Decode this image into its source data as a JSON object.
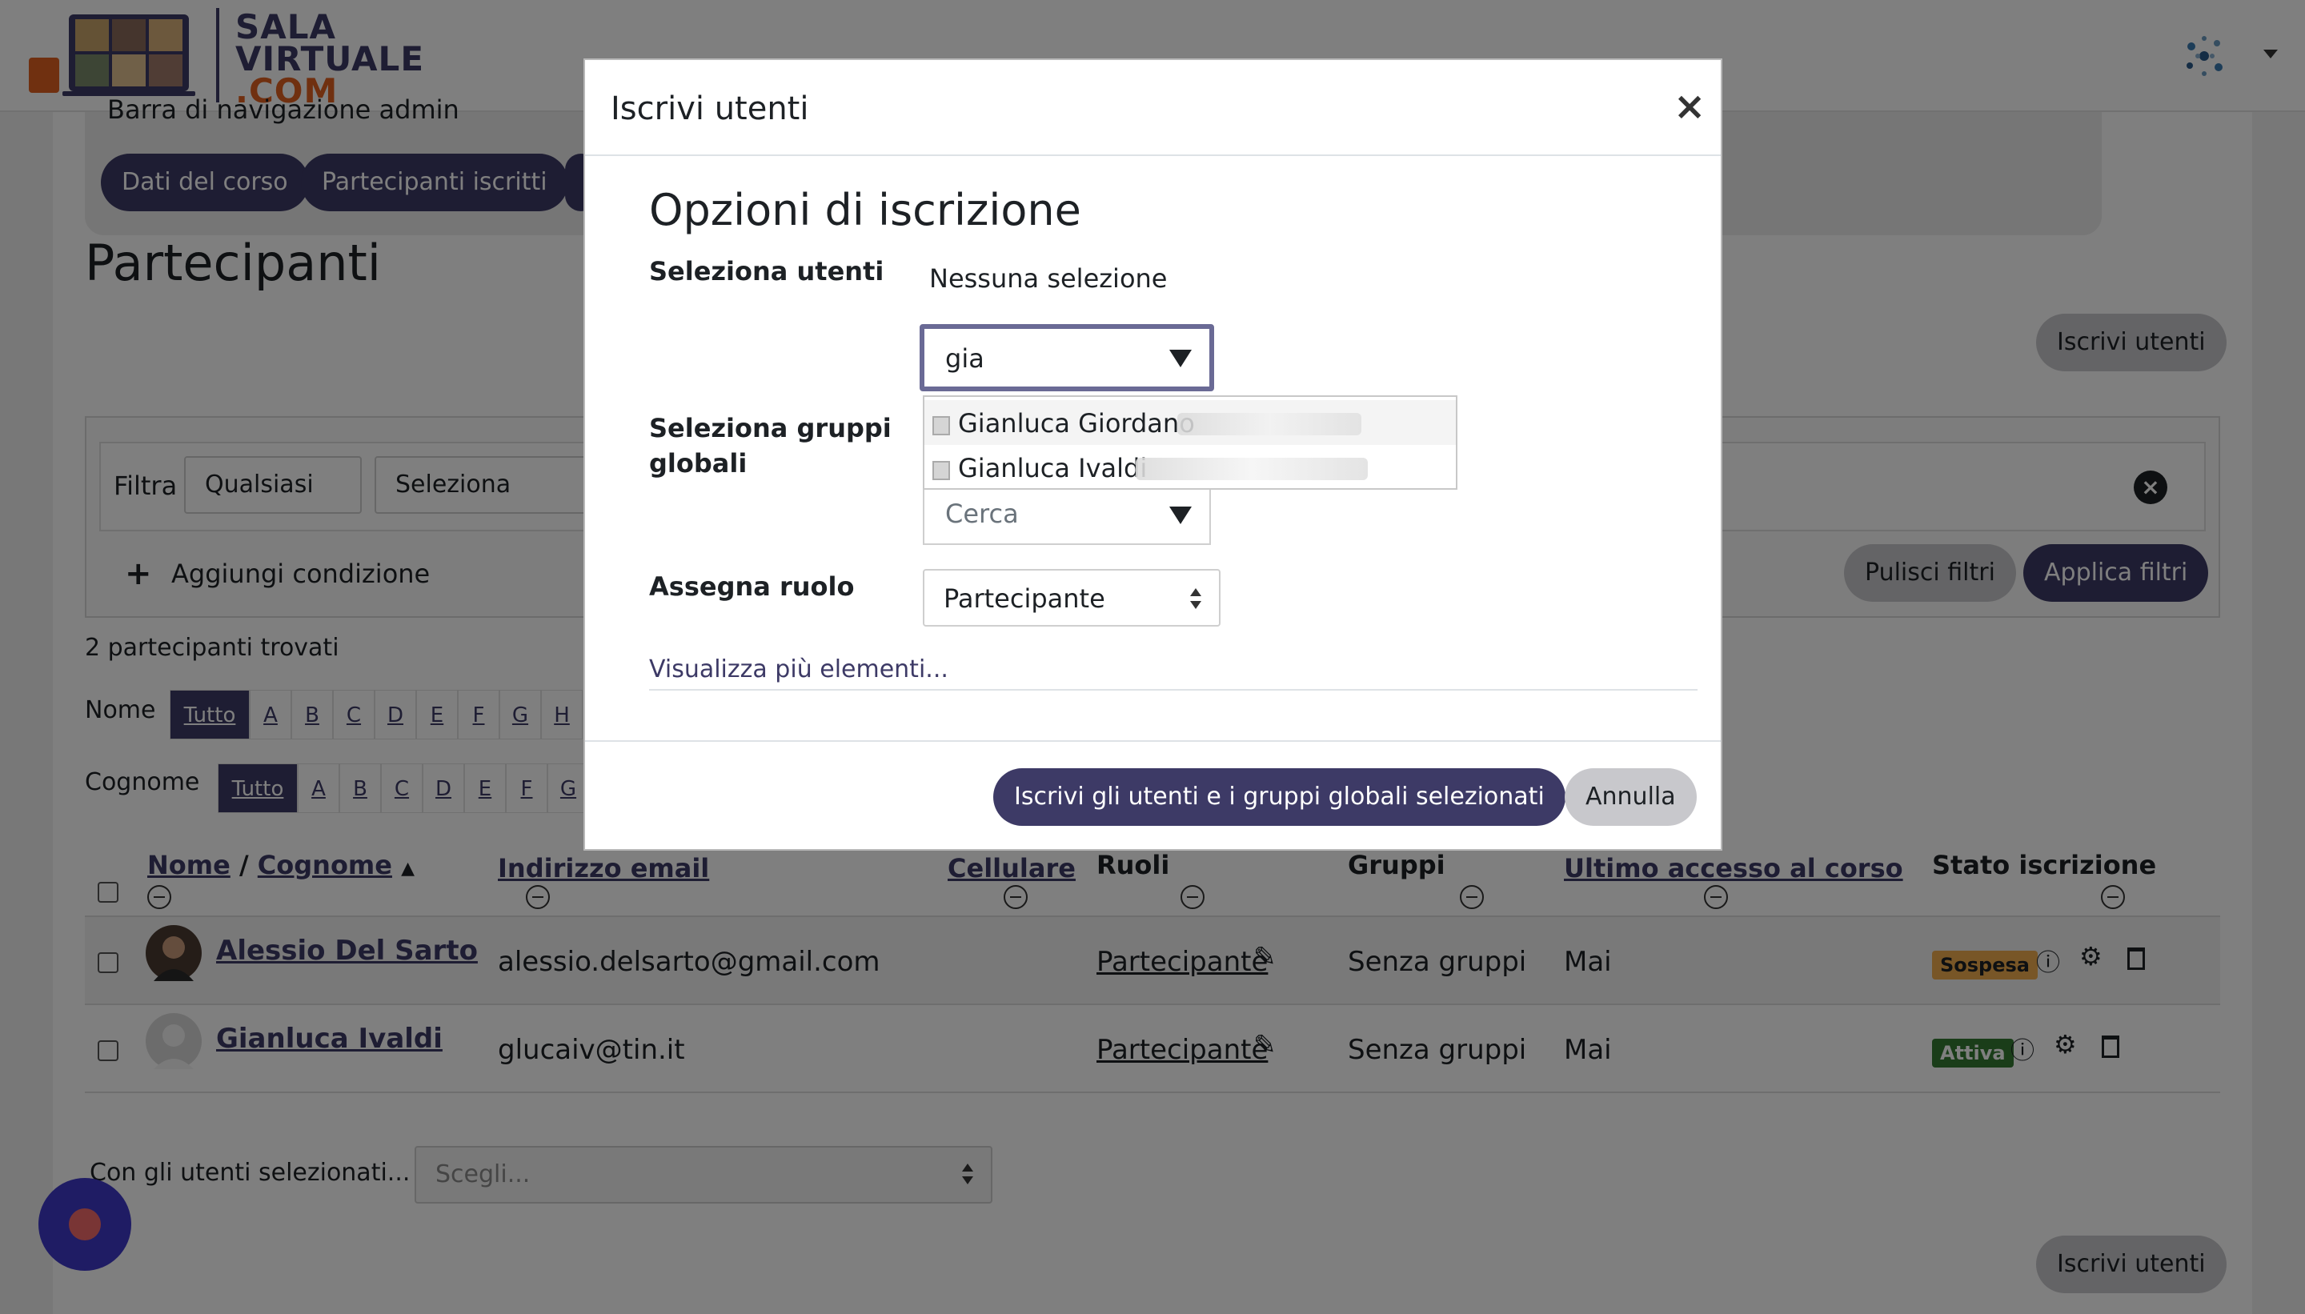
{
  "site": {
    "logo_line1": "SALA",
    "logo_line2": "VIRTUALE",
    "logo_line3": ".COM"
  },
  "admin_nav": {
    "title": "Barra di navigazione admin",
    "pills": [
      "Dati del corso",
      "Partecipanti iscritti"
    ]
  },
  "page": {
    "title": "Partecipanti",
    "enrol_button": "Iscrivi utenti",
    "enrol_button_bottom": "Iscrivi utenti"
  },
  "filters": {
    "label": "Filtra",
    "match_select": "Qualsiasi",
    "type_select": "Seleziona",
    "add_condition": "Aggiungi condizione",
    "clear": "Pulisci filtri",
    "apply": "Applica filtri"
  },
  "results": {
    "count_text": "2 partecipanti trovati",
    "first_name_label": "Nome",
    "last_name_label": "Cognome",
    "all_label": "Tutto",
    "letters_first": [
      "A",
      "B",
      "C",
      "D",
      "E",
      "F",
      "G",
      "H"
    ],
    "letters_last": [
      "A",
      "B",
      "C",
      "D",
      "E",
      "F",
      "G"
    ]
  },
  "table": {
    "headers": {
      "name": "Nome",
      "separator": "/",
      "surname": "Cognome",
      "email": "Indirizzo email",
      "phone": "Cellulare",
      "roles": "Ruoli",
      "groups": "Gruppi",
      "last_access": "Ultimo accesso al corso",
      "status": "Stato iscrizione"
    },
    "rows": [
      {
        "name": "Alessio Del Sarto",
        "email": "alessio.delsarto@gmail.com",
        "role": "Partecipante",
        "groups": "Senza gruppi",
        "last_access": "Mai",
        "status": "Sospesa"
      },
      {
        "name": "Gianluca Ivaldi",
        "email": "glucaiv@tin.it",
        "role": "Partecipante",
        "groups": "Senza gruppi",
        "last_access": "Mai",
        "status": "Attiva"
      }
    ]
  },
  "bulk": {
    "label": "Con gli utenti selezionati...",
    "select": "Scegli..."
  },
  "modal": {
    "title": "Iscrivi utenti",
    "close": "×",
    "section_title": "Opzioni di iscrizione",
    "select_users_label": "Seleziona utenti",
    "no_selection": "Nessuna selezione",
    "search_value": "gia",
    "suggestions": [
      "Gianluca Giordano",
      "Gianluca Ivaldi"
    ],
    "global_groups_label_1": "Seleziona gruppi",
    "global_groups_label_2": "globali",
    "groups_search_placeholder": "Cerca",
    "assign_role_label": "Assegna ruolo",
    "role_value": "Partecipante",
    "show_more": "Visualizza più elementi...",
    "submit": "Iscrivi gli utenti e i gruppi globali selezionati",
    "cancel": "Annulla"
  },
  "colors": {
    "brand": "#3d3a66",
    "accent_orange": "#e06020",
    "badge_suspended": "#f0ad4e",
    "badge_active": "#357a32",
    "fab": "#3f39c9"
  }
}
